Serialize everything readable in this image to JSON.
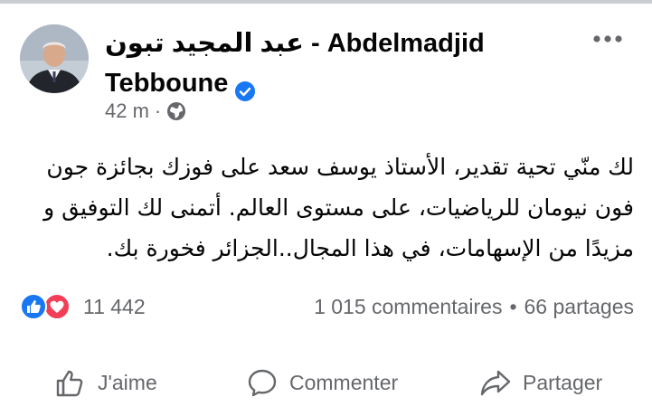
{
  "post": {
    "author_line1": "عبد المجيد تبون - Abdelmadjid",
    "author_line2": "Tebboune",
    "time": "42 m",
    "meta_separator": "·",
    "text": "لك منّي تحية تقدير، الأستاذ يوسف سعد على فوزك بجائزة جون فون نيومان للرياضيات، على مستوى العالم. أتمنى لك التوفيق و مزيدًا من الإسهامات، في هذا المجال..الجزائر فخورة بك."
  },
  "reactions": {
    "count": "11 442"
  },
  "stats": {
    "comments": "1 015 commentaires",
    "separator": "•",
    "shares": "66 partages"
  },
  "actions": {
    "like": "J'aime",
    "comment": "Commenter",
    "share": "Partager"
  },
  "icons": {
    "verified": "verified-badge-icon",
    "audience": "globe-icon",
    "more": "more-options-icon",
    "like_reaction": "like-reaction-icon",
    "love_reaction": "love-reaction-icon",
    "like_action": "thumbs-up-icon",
    "comment_action": "comment-bubble-icon",
    "share_action": "share-arrow-icon"
  },
  "colors": {
    "brand_blue": "#1877f2",
    "love_red": "#f33e58",
    "secondary_text": "#65676b",
    "primary_text": "#050505"
  }
}
